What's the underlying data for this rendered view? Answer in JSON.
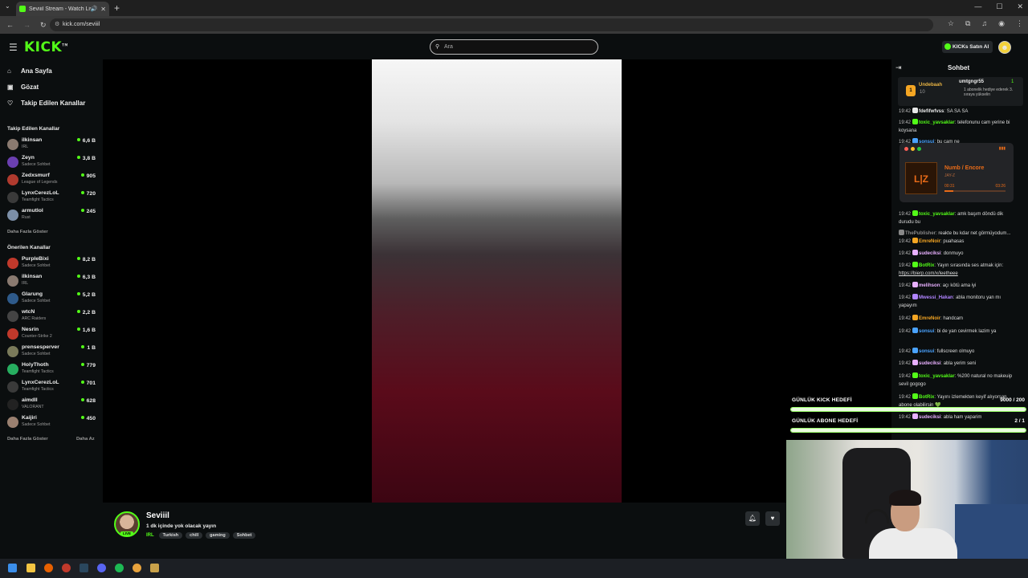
{
  "browser": {
    "tab_title": "Seviiil Stream - Watch Live",
    "url": "kick.com/seviiil",
    "new_tab": "+",
    "win_min": "—",
    "win_max": "☐",
    "win_close": "✕"
  },
  "header": {
    "logo": "KICK",
    "search_placeholder": "Ara",
    "buy_kicks": "KICKs Satın Al"
  },
  "sidebar": {
    "nav": [
      {
        "label": "Ana Sayfa",
        "icon": "home-icon"
      },
      {
        "label": "Gözat",
        "icon": "browse-icon"
      },
      {
        "label": "Takip Edilen Kanallar",
        "icon": "heart-icon"
      }
    ],
    "followed_title": "Takip Edilen Kanallar",
    "followed": [
      {
        "name": "ilkinsan",
        "category": "IRL",
        "viewers": "6,6 B",
        "color": "#8a7a70"
      },
      {
        "name": "Zeyn",
        "category": "Sadece Sohbet",
        "viewers": "3,8 B",
        "color": "#6b3fb0"
      },
      {
        "name": "Zedxsmurf",
        "category": "League of Legends",
        "viewers": "905",
        "color": "#b03a2e"
      },
      {
        "name": "LynxCerezLoL",
        "category": "Teamfight Tactics",
        "viewers": "720",
        "color": "#3a3a3a"
      },
      {
        "name": "armutlol",
        "category": "Rust",
        "viewers": "245",
        "color": "#7c8fa8"
      }
    ],
    "more_1": "Daha Fazla Göster",
    "recommended_title": "Önerilen Kanallar",
    "recommended": [
      {
        "name": "PurpleBixi",
        "category": "Sadece Sohbet",
        "viewers": "8,2 B",
        "color": "#c0392b"
      },
      {
        "name": "ilkinsan",
        "category": "IRL",
        "viewers": "6,3 B",
        "color": "#8a7a70"
      },
      {
        "name": "Glarung",
        "category": "Sadece Sohbet",
        "viewers": "5,2 B",
        "color": "#2e5a8a"
      },
      {
        "name": "wtcN",
        "category": "ARC Raiders",
        "viewers": "2,2 B",
        "color": "#444"
      },
      {
        "name": "Nesrin",
        "category": "Counter-Strike 2",
        "viewers": "1,6 B",
        "color": "#c0392b"
      },
      {
        "name": "prensesperver",
        "category": "Sadece Sohbet",
        "viewers": "1 B",
        "color": "#7a7a5a"
      },
      {
        "name": "HolyThoth",
        "category": "Teamfight Tactics",
        "viewers": "779",
        "color": "#27ae60"
      },
      {
        "name": "LynxCerezLoL",
        "category": "Teamfight Tactics",
        "viewers": "701",
        "color": "#3a3a3a"
      },
      {
        "name": "aimdll",
        "category": "VALORANT",
        "viewers": "628",
        "color": "#222"
      },
      {
        "name": "Kaijiri",
        "category": "Sadece Sohbet",
        "viewers": "450",
        "color": "#9a8070"
      }
    ],
    "more_2": "Daha Fazla Göster",
    "less": "Daha Az"
  },
  "stream": {
    "name": "Seviiil",
    "live": "LIVE",
    "title": "1 dk içinde yok olacak yayın",
    "category": "IRL",
    "tags": [
      "Turkish",
      "chill",
      "gaming",
      "Sohbet"
    ]
  },
  "chat": {
    "title": "Sohbet",
    "pinned": {
      "user1": "Undebaah",
      "count1": "10",
      "medal": "1",
      "user2": "umtgngr55",
      "count2": "1",
      "text2": "1 abonelik hediye ederek 3. sıraya yükselin"
    },
    "messages": [
      {
        "time": "19:42",
        "user": "fdefifwfvss",
        "color": "#e8e8e8",
        "text": "SA SA SA"
      },
      {
        "time": "19:42",
        "user": "toxic_yavsaklar",
        "color": "#53fc18",
        "text": "telefonunu cam yerine bi koysana"
      },
      {
        "time": "19:42",
        "user": "sonsui",
        "color": "#4aa3ff",
        "text": "bu cam ne"
      },
      {
        "time": "19:42",
        "user": "toxic_yavsaklar",
        "color": "#53fc18",
        "text": "amk başım döndü dik durudu bu"
      },
      {
        "time": "",
        "user": "ThePublisher",
        "color": "#888",
        "text": "reakte bu kdar net görmüyodum..."
      },
      {
        "time": "19:42",
        "user": "EmreNoir",
        "color": "#f5a623",
        "text": "puahasas"
      },
      {
        "time": "19:42",
        "user": "sudeciksi",
        "color": "#e8b0ff",
        "text": "donmuyo"
      },
      {
        "time": "19:42",
        "user": "BotRix",
        "color": "#53fc18",
        "text": "Yayın sırasında ses atmak için: ",
        "link": "https://bierp.com/x/leetheee"
      },
      {
        "time": "19:42",
        "user": "melihson",
        "color": "#e8b0ff",
        "text": "açı kötü ama iyi"
      },
      {
        "time": "19:42",
        "user": "Mwessi_Hakan",
        "color": "#b084ff",
        "text": "abla monitoru yan mı yapayım"
      },
      {
        "time": "19:42",
        "user": "EmreNoir",
        "color": "#f5a623",
        "text": "handcam"
      },
      {
        "time": "19:42",
        "user": "sonsui",
        "color": "#4aa3ff",
        "text": "bi de yan cevirmek lazim ya"
      },
      {
        "time": "19:42",
        "user": "sonsui",
        "color": "#4aa3ff",
        "text": "fullscreen olmuyo"
      },
      {
        "time": "19:42",
        "user": "sudeciksi",
        "color": "#e8b0ff",
        "text": "abla yerim seni"
      },
      {
        "time": "19:42",
        "user": "toxic_yavsaklar",
        "color": "#53fc18",
        "text": "%200 natural no makeuip sevil gogogo"
      },
      {
        "time": "19:42",
        "user": "BotRix",
        "color": "#53fc18",
        "text": "Yayını izlemekten keyif alıyorsan abone olabilirsin 💚"
      },
      {
        "time": "19:42",
        "user": "sudeciksi",
        "color": "#e8b0ff",
        "text": "abla ham yaparim"
      }
    ]
  },
  "goals": {
    "kick_label": "GÜNLÜK KICK HEDEFİ",
    "kick_value": "9000 / 200",
    "kick_progress": 1.0,
    "sub_label": "GÜNLÜK ABONE HEDEFİ",
    "sub_value": "2 / 1",
    "sub_progress": 1.0
  },
  "music": {
    "song": "Numb / Encore",
    "artist": "JAY-Z",
    "elapsed": "00:31",
    "total": "03:26",
    "progress": 0.15
  }
}
